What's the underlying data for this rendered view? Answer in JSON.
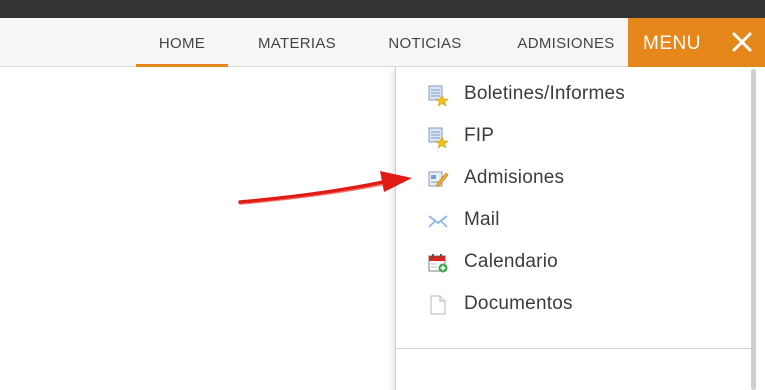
{
  "nav": {
    "items": [
      {
        "label": "HOME",
        "active": true
      },
      {
        "label": "MATERIAS",
        "active": false
      },
      {
        "label": "NOTICIAS",
        "active": false
      },
      {
        "label": "ADMISIONES",
        "active": false
      }
    ],
    "menu_label": "MENU",
    "accent_color": "#e5871a",
    "topbar_color": "#333333"
  },
  "dropdown": {
    "items": [
      {
        "label": "Boletines/Informes",
        "icon": "report-star-icon"
      },
      {
        "label": "FIP",
        "icon": "report-star-icon"
      },
      {
        "label": "Admisiones",
        "icon": "edit-form-icon"
      },
      {
        "label": "Mail",
        "icon": "mail-icon"
      },
      {
        "label": "Calendario",
        "icon": "calendar-icon"
      },
      {
        "label": "Documentos",
        "icon": "document-icon"
      }
    ]
  },
  "annotation": {
    "arrow_color": "#e21a14",
    "arrow_target": "Admisiones"
  }
}
